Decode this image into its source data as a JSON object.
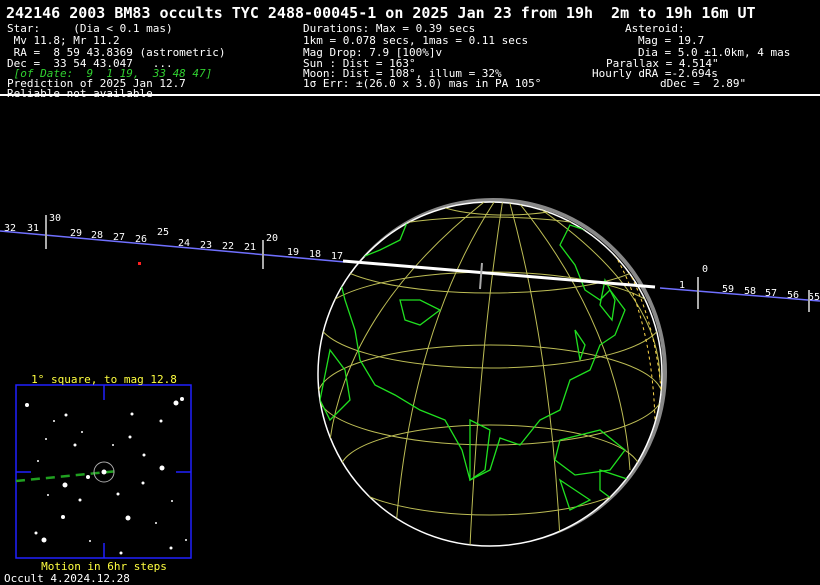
{
  "title": "242146 2003 BM83 occults TYC 2488-00045-1 on 2025 Jan 23 from 19h  2m to 19h 16m UT",
  "star": [
    "Star:     (Dia < 0.1 mas)",
    " Mv 11.8; Mr 11.2",
    " RA =  8 59 43.8369 (astrometric)",
    "Dec =  33 54 43.047   ...",
    " [of Date:  9  1 19,  33 48 47]",
    "Prediction of 2025 Jan 12.7",
    "Reliable not available"
  ],
  "durations": [
    "Durations: Max = 0.39 secs",
    "1km = 0.078 secs, 1mas = 0.11 secs",
    "Mag Drop: 7.9 [100%]v",
    "Sun : Dist = 163°",
    "Moon: Dist = 108°, illum = 32%",
    "1σ Err: ±(26.0 x 3.0) mas in PA 105°"
  ],
  "asteroid": [
    "Asteroid:",
    "Mag = 19.7",
    "Dia = 5.0 ±1.0km, 4 mas",
    "Parallax = 4.514\"",
    "Hourly dRA =-2.694s",
    "dDec =  2.89\""
  ],
  "track_labels_left": [
    "32",
    "31",
    "30",
    "29",
    "28",
    "27",
    "26",
    "25",
    "24",
    "23",
    "22",
    "21",
    "20",
    "19",
    "18",
    "17"
  ],
  "track_labels_right": [
    "1",
    "0",
    "59",
    "58",
    "57",
    "56",
    "55"
  ],
  "finder": {
    "heading": "1° square, to mag 12.8",
    "footer": "Motion in 6hr steps"
  },
  "version": "Occult 4.2024.12.28",
  "colors": {
    "background": "#000000",
    "text": "#ffffff",
    "coastline": "#20e020",
    "graticule": "#c8c860",
    "finder_frame": "#2020ff",
    "note": "#ffff40",
    "track": "#8080ff"
  }
}
